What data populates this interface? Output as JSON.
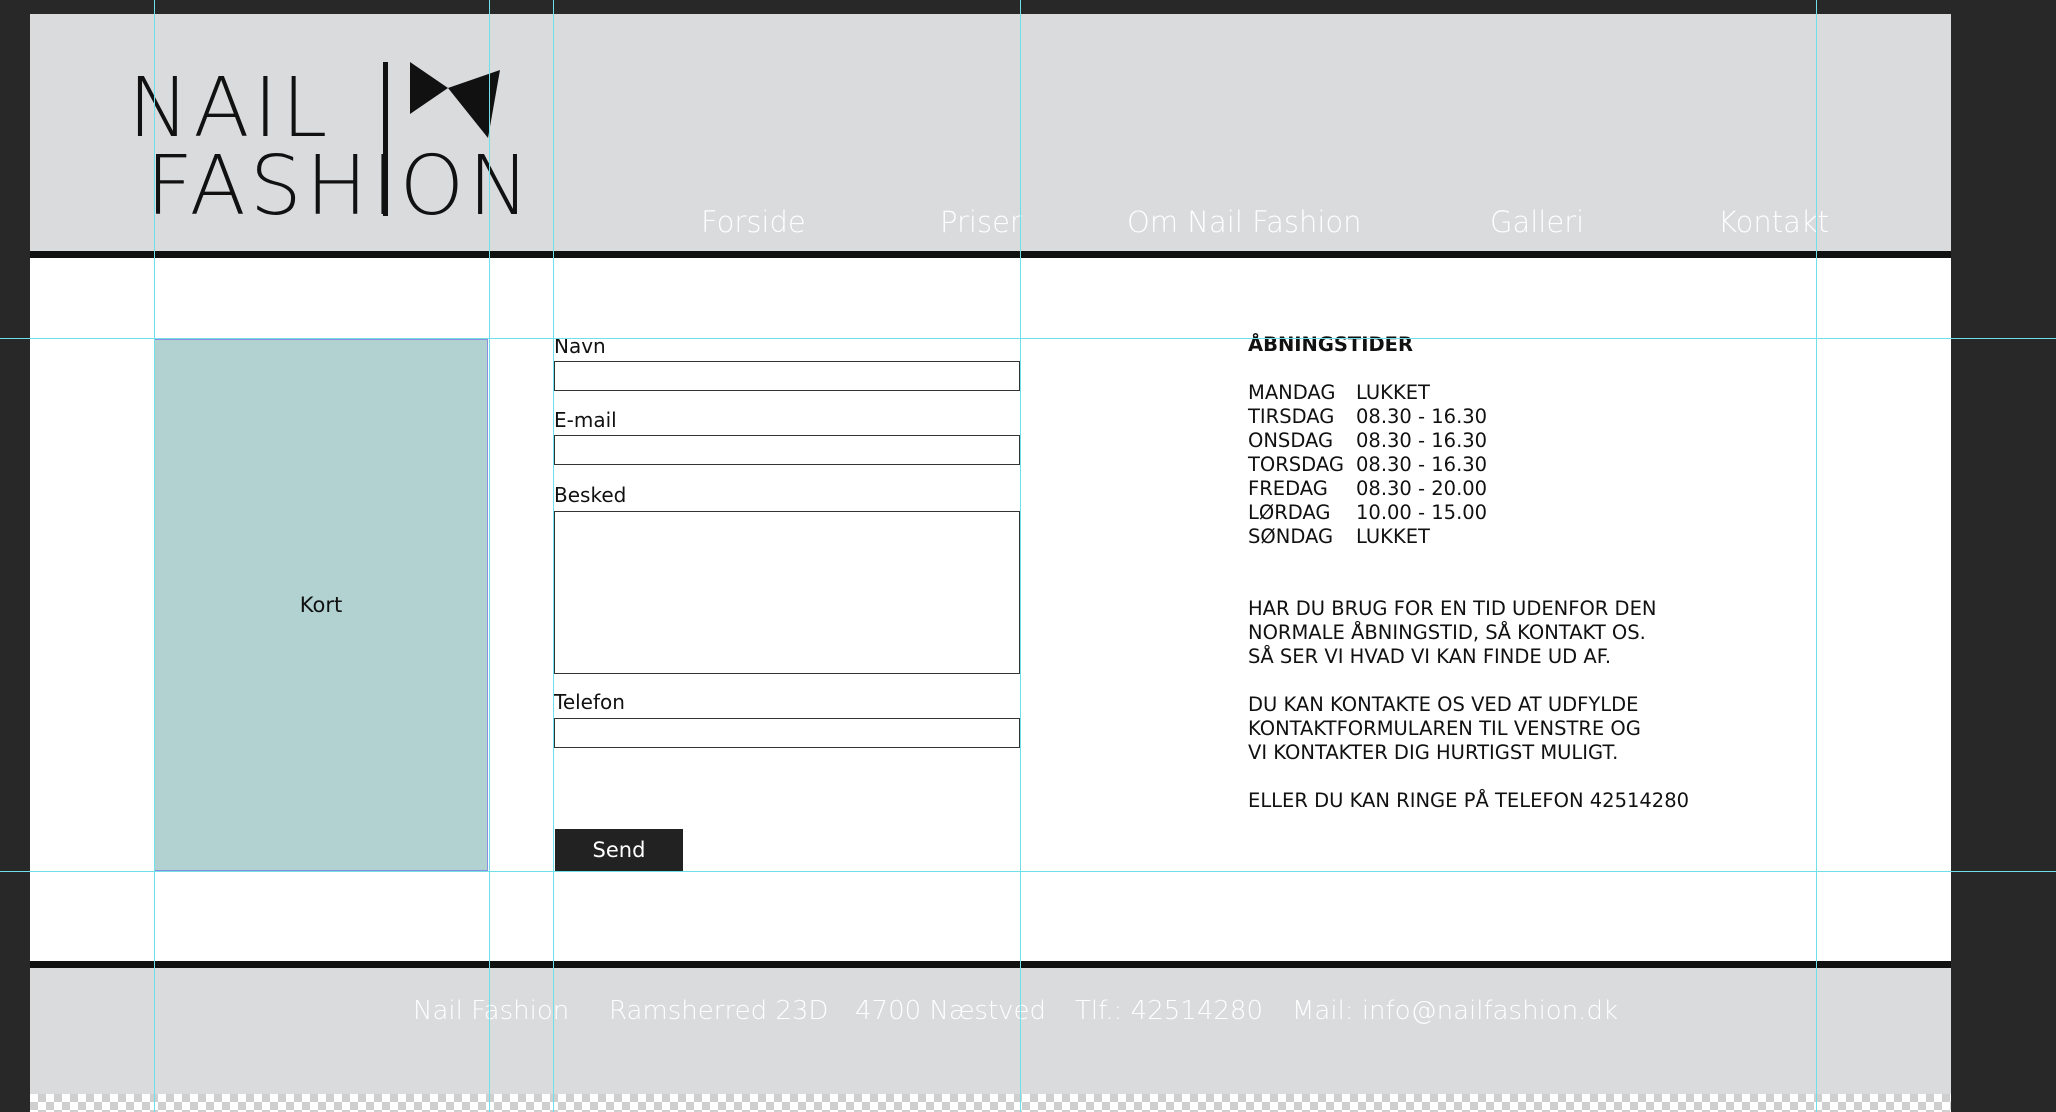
{
  "brand": {
    "logo_line1": "NAIL",
    "logo_line2": "FASHION"
  },
  "nav": {
    "items": [
      {
        "label": "Forside"
      },
      {
        "label": "Priser"
      },
      {
        "label": "Om Nail Fashion"
      },
      {
        "label": "Galleri"
      },
      {
        "label": "Kontakt"
      }
    ]
  },
  "map": {
    "label": "Kort"
  },
  "form": {
    "name_label": "Navn",
    "email_label": "E-mail",
    "message_label": "Besked",
    "phone_label": "Telefon",
    "name_value": "",
    "email_value": "",
    "message_value": "",
    "phone_value": "",
    "send_label": "Send"
  },
  "hours": {
    "title": "ÅBNINGSTIDER",
    "rows": [
      {
        "day": "MANDAG",
        "time": "LUKKET"
      },
      {
        "day": "TIRSDAG",
        "time": "08.30 - 16.30"
      },
      {
        "day": "ONSDAG",
        "time": "08.30 - 16.30"
      },
      {
        "day": "TORSDAG",
        "time": "08.30 - 16.30"
      },
      {
        "day": "FREDAG",
        "time": "08.30 - 20.00"
      },
      {
        "day": "LØRDAG",
        "time": "10.00 - 15.00"
      },
      {
        "day": "SØNDAG",
        "time": "LUKKET"
      }
    ],
    "para1": [
      "HAR DU BRUG FOR EN TID UDENFOR DEN",
      "NORMALE ÅBNINGSTID, SÅ KONTAKT OS.",
      "SÅ SER VI HVAD VI KAN FINDE UD AF."
    ],
    "para2": [
      "DU KAN KONTAKTE OS VED AT UDFYLDE",
      "KONTAKTFORMULAREN TIL VENSTRE OG",
      "VI KONTAKTER DIG HURTIGST MULIGT."
    ],
    "para3": "ELLER DU KAN RINGE  PÅ TELEFON 42514280"
  },
  "footer": {
    "name": "Nail Fashion",
    "street": "Ramsherred 23D",
    "city": "4700 Næstved",
    "phone": "Tlf.: 42514280",
    "email": "Mail: info@nailfashion.dk"
  },
  "colors": {
    "header_bg": "#dadbdc",
    "map_bg": "#b2d1d1",
    "button_bg": "#222222",
    "guide": "#6fe0e8"
  }
}
